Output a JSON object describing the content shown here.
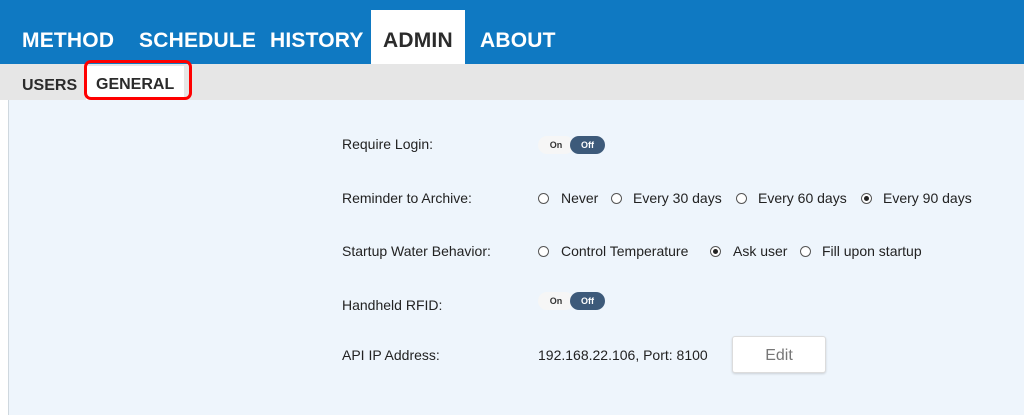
{
  "top_tabs": [
    {
      "label": "METHOD"
    },
    {
      "label": "SCHEDULE"
    },
    {
      "label": "HISTORY"
    },
    {
      "label": "ADMIN"
    },
    {
      "label": "ABOUT"
    }
  ],
  "sub_tabs": [
    {
      "label": "USERS"
    },
    {
      "label": "GENERAL"
    }
  ],
  "settings": {
    "require_login": {
      "label": "Require Login:",
      "on": "On",
      "off": "Off",
      "state": "Off"
    },
    "reminder": {
      "label": "Reminder to Archive:",
      "options": [
        "Never",
        "Every 30 days",
        "Every 60 days",
        "Every 90 days"
      ],
      "selected": "Every 90 days"
    },
    "startup": {
      "label": "Startup Water Behavior:",
      "options": [
        "Control Temperature",
        "Ask user",
        "Fill upon startup"
      ],
      "selected": "Ask user"
    },
    "rfid": {
      "label": "Handheld RFID:",
      "on": "On",
      "off": "Off",
      "state": "Off"
    },
    "api": {
      "label": "API IP Address:",
      "value": "192.168.22.106, Port: 8100",
      "edit": "Edit"
    }
  },
  "colors": {
    "nav_bg": "#0f79c2",
    "content_bg": "#eef5fc",
    "highlight": "#ff0000",
    "toggle_off": "#3d5a7a"
  }
}
